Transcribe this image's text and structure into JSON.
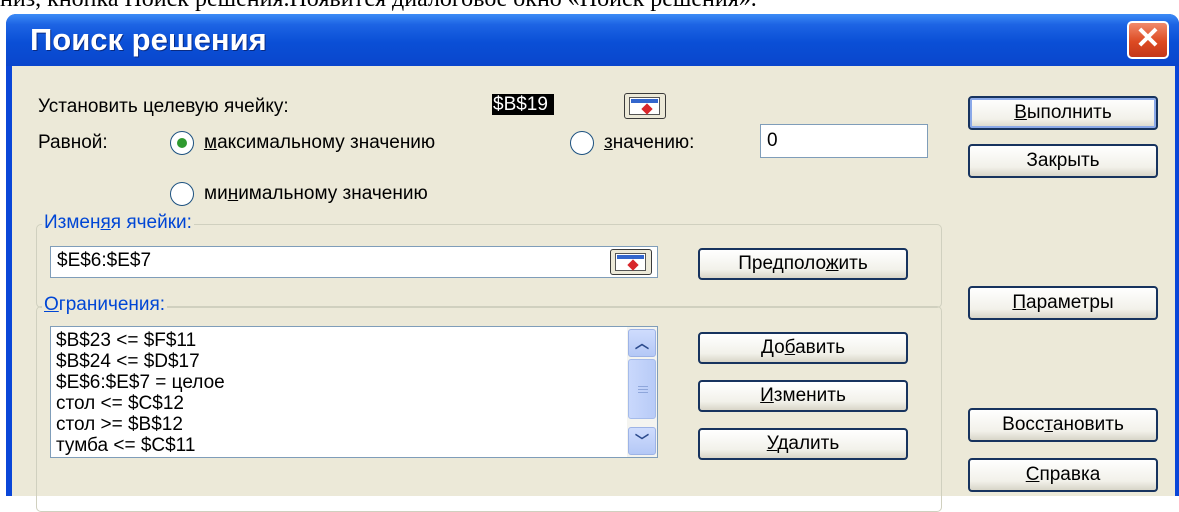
{
  "document_text": "низ, кнопка Поиск решения.Появится диалоговое окно «Поиск решения».",
  "dialog": {
    "title": "Поиск решения",
    "close_icon": "close-icon",
    "target_cell_label": "Установить целевую ячейку:",
    "target_cell_value": "$B$19",
    "equal_to_label": "Равной:",
    "radio_max_label": "максимальному значению",
    "radio_value_label": "значению:",
    "value_input": "0",
    "radio_min_label": "минимальному значению",
    "selected_option": "max",
    "changing_cells_label": "Изменяя ячейки:",
    "changing_cells_value": "$E$6:$E$7",
    "constraints_label": "Ограничения:",
    "constraints": [
      "$B$23 <= $F$11",
      "$B$24 <= $D$17",
      "$E$6:$E$7 = целое",
      "стол <= $C$12",
      "стол >= $B$12",
      "тумба <= $C$11"
    ],
    "buttons": {
      "solve": "Выполнить",
      "close": "Закрыть",
      "guess": "Предположить",
      "options": "Параметры",
      "add": "Добавить",
      "change": "Изменить",
      "delete": "Удалить",
      "reset": "Восстановить",
      "help": "Справка"
    },
    "colors": {
      "titlebar": "#0a4fd6",
      "client": "#ece9d8",
      "close": "#dd4a22",
      "group_label": "#0046d5"
    }
  }
}
